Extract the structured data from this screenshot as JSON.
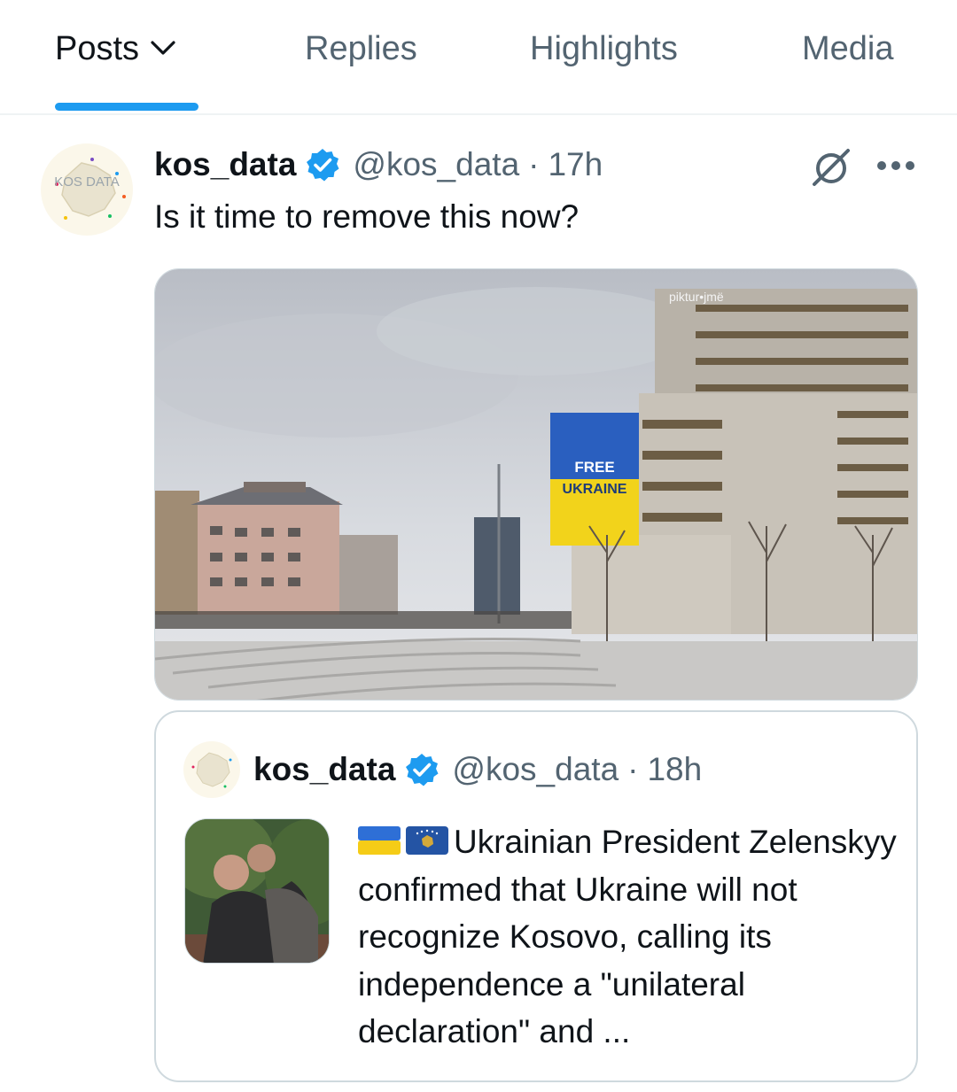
{
  "tabs": [
    {
      "label": "Posts",
      "active": true
    },
    {
      "label": "Replies",
      "active": false
    },
    {
      "label": "Highlights",
      "active": false
    },
    {
      "label": "Media",
      "active": false
    }
  ],
  "post": {
    "display_name": "kos_data",
    "username": "@kos_data",
    "separator": "·",
    "time": "17h",
    "text": "Is it time to remove this now?",
    "photo": {
      "billboard_line1": "FREE",
      "billboard_line2": "UKRAINE",
      "rooftop_sign": "piktur•jmë"
    },
    "avatar_text": "KOS DATA"
  },
  "quote": {
    "display_name": "kos_data",
    "username": "@kos_data",
    "separator": "·",
    "time": "18h",
    "flags": [
      "ukraine-flag",
      "kosovo-flag"
    ],
    "text": "Ukrainian President Zelenskyy confirmed that Ukraine will not recognize Kosovo, calling its independence a \"unilateral declaration\" and ..."
  },
  "colors": {
    "accent": "#1d9bf0",
    "text_primary": "#0f1419",
    "text_secondary": "#536471",
    "border": "#cfd9de"
  }
}
